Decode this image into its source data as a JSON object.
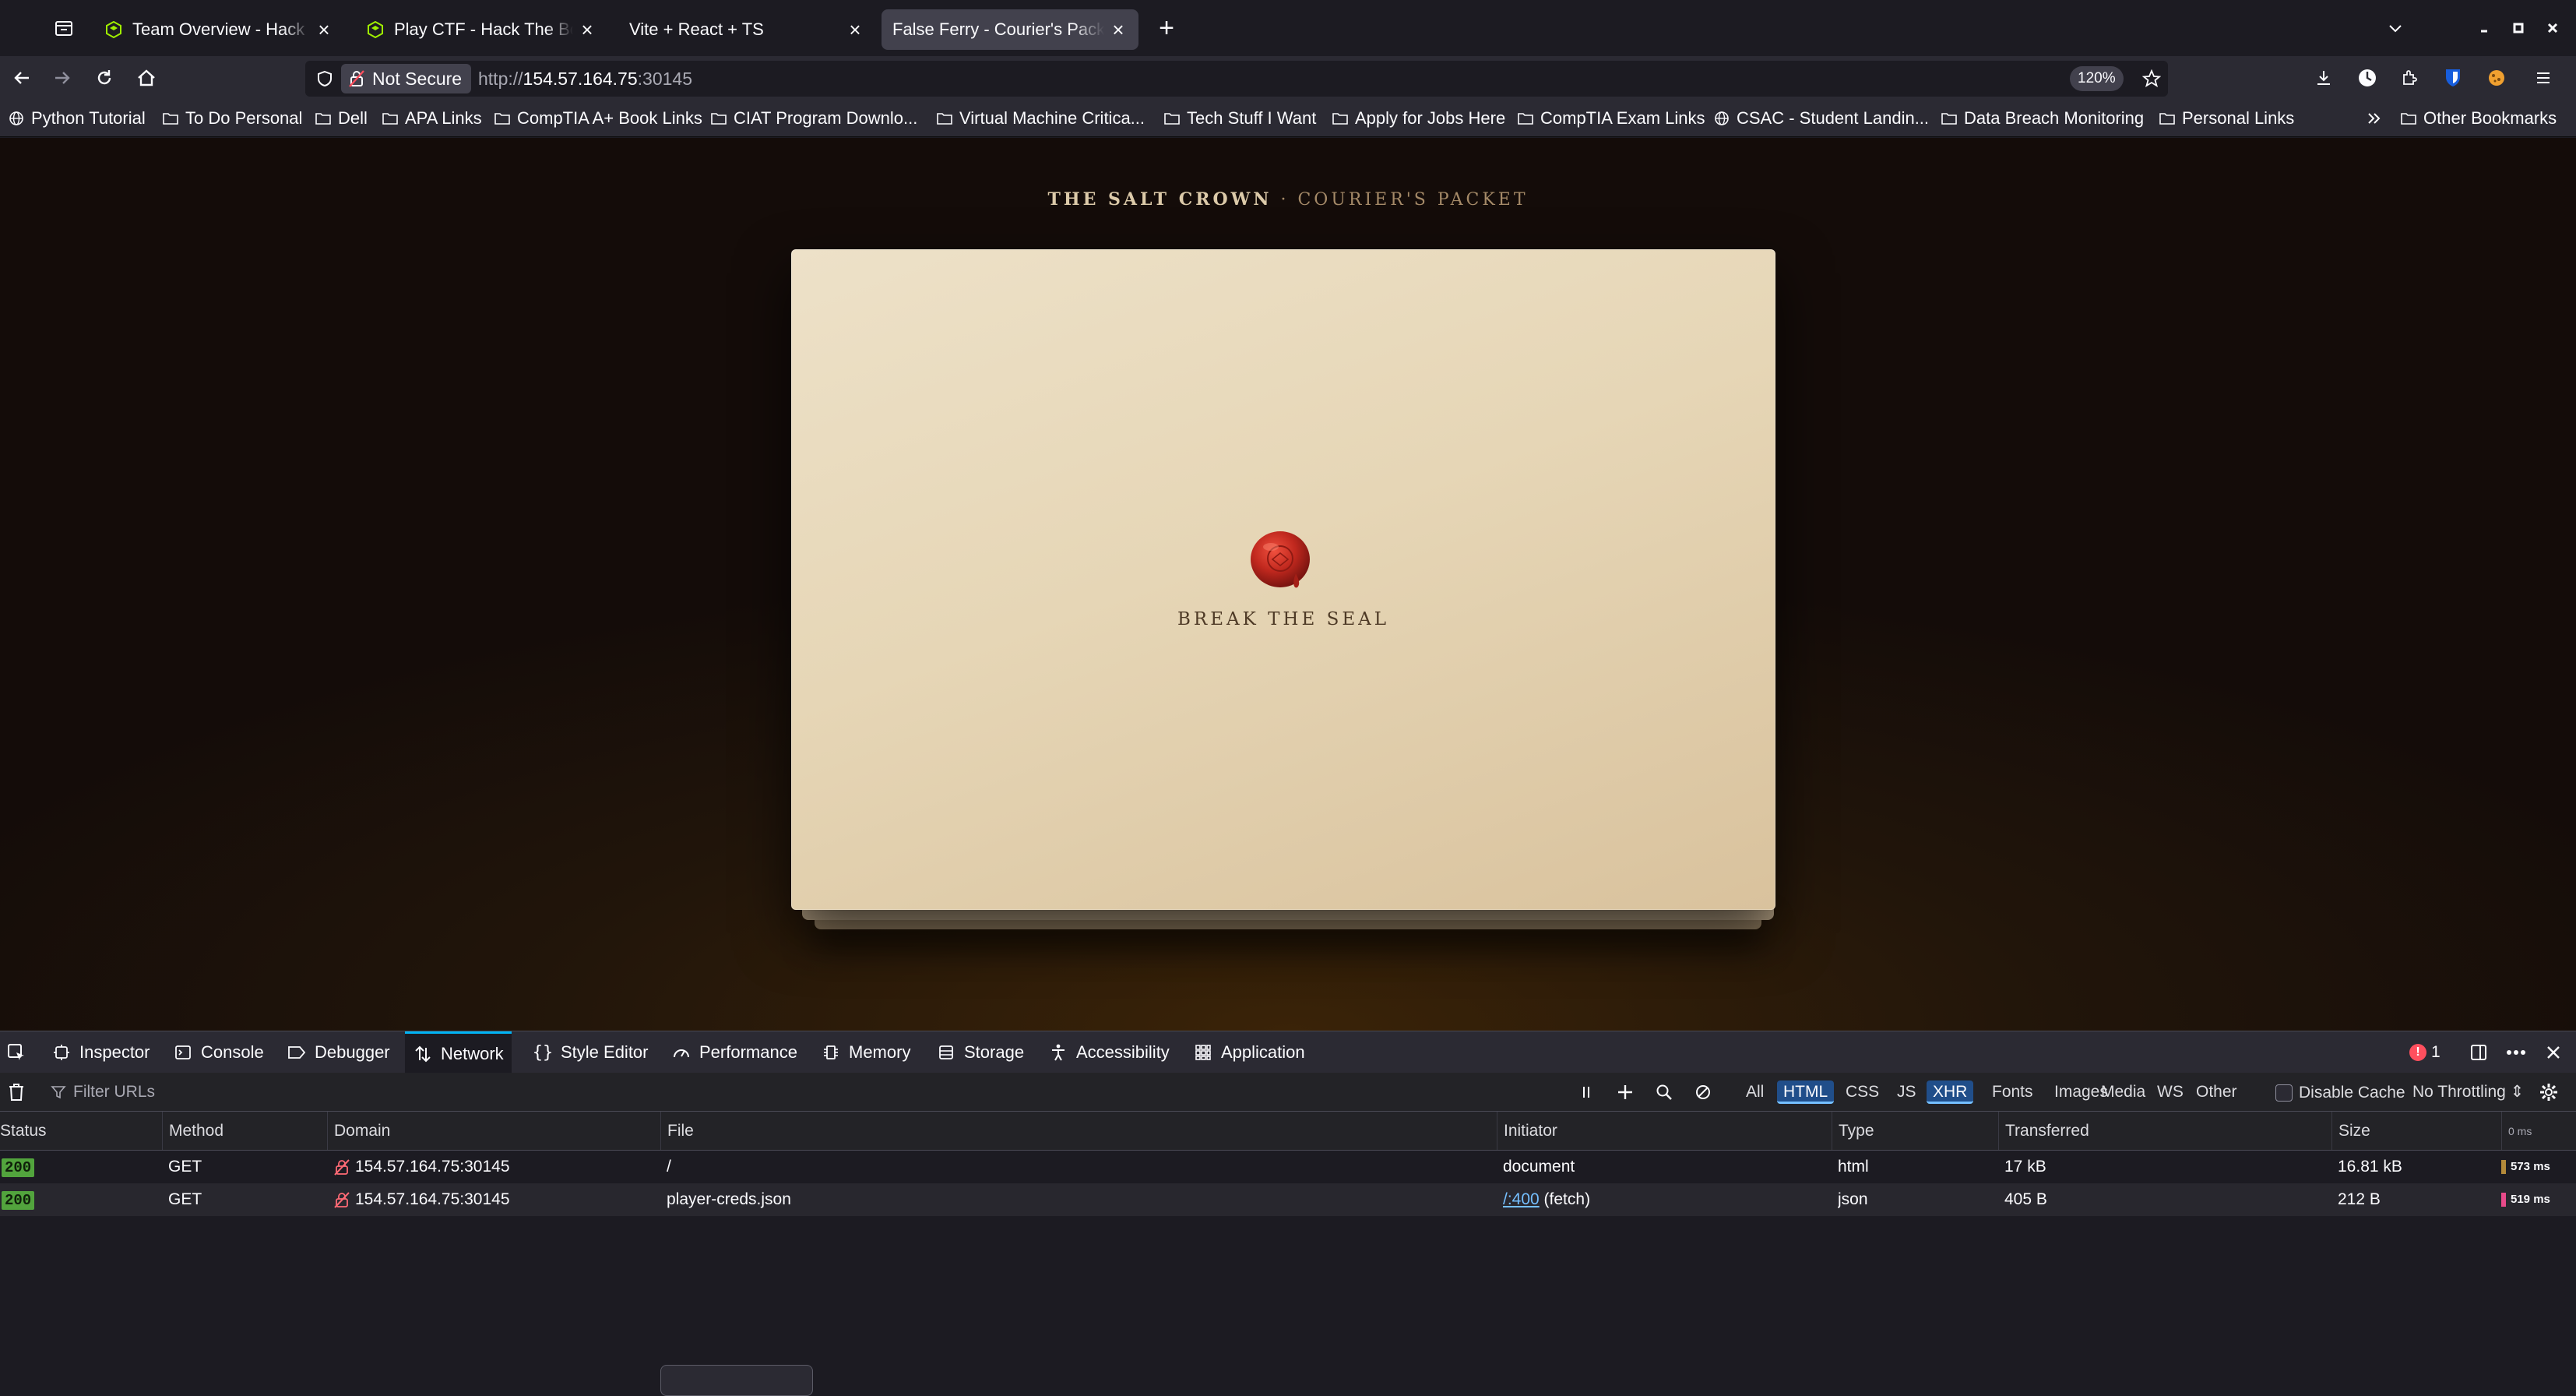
{
  "browser": {
    "tabs": [
      {
        "title": "Team Overview - Hack The Box",
        "active": false
      },
      {
        "title": "Play CTF - Hack The Box CTF",
        "active": false
      },
      {
        "title": "Vite + React + TS",
        "active": false
      },
      {
        "title": "False Ferry - Courier's Packet",
        "active": true
      }
    ],
    "new_tab_label": "+",
    "close_label": "×"
  },
  "navbar": {
    "not_secure_label": "Not Secure",
    "url_prefix": "http://",
    "url_host": "154.57.164.75",
    "url_port": ":30145",
    "zoom": "120%"
  },
  "bookmarks": [
    {
      "label": "Python Tutorial",
      "icon": "globe-icon"
    },
    {
      "label": "To Do Personal",
      "icon": "folder-icon"
    },
    {
      "label": "Dell",
      "icon": "folder-icon"
    },
    {
      "label": "APA Links",
      "icon": "folder-icon"
    },
    {
      "label": "CompTIA A+ Book Links",
      "icon": "folder-icon"
    },
    {
      "label": "CIAT Program Downlo...",
      "icon": "folder-icon"
    },
    {
      "label": "Virtual Machine Critica...",
      "icon": "folder-icon"
    },
    {
      "label": "Tech Stuff I Want",
      "icon": "folder-icon"
    },
    {
      "label": "Apply for Jobs Here",
      "icon": "folder-icon"
    },
    {
      "label": "CompTIA Exam Links",
      "icon": "folder-icon"
    },
    {
      "label": "CSAC - Student Landin...",
      "icon": "globe-icon"
    },
    {
      "label": "Data Breach Monitoring",
      "icon": "folder-icon"
    },
    {
      "label": "Personal Links",
      "icon": "folder-icon"
    }
  ],
  "other_bookmarks": "Other Bookmarks",
  "page": {
    "heading_main": "THE SALT CROWN",
    "heading_sep": " · ",
    "heading_sub": "COURIER'S PACKET",
    "seal_label": "BREAK THE SEAL",
    "seal_color": "#c0281e",
    "paper_color": "#e6d6b6"
  },
  "devtools": {
    "tabs": [
      {
        "label": "Inspector",
        "icon": "inspector-icon"
      },
      {
        "label": "Console",
        "icon": "console-icon"
      },
      {
        "label": "Debugger",
        "icon": "debugger-icon"
      },
      {
        "label": "Network",
        "icon": "network-icon",
        "active": true
      },
      {
        "label": "Style Editor",
        "icon": "braces-icon"
      },
      {
        "label": "Performance",
        "icon": "gauge-icon"
      },
      {
        "label": "Memory",
        "icon": "memory-icon"
      },
      {
        "label": "Storage",
        "icon": "storage-icon"
      },
      {
        "label": "Accessibility",
        "icon": "accessibility-icon"
      },
      {
        "label": "Application",
        "icon": "grid-icon"
      }
    ],
    "error_count": "1",
    "filter_placeholder": "Filter URLs",
    "type_filters": [
      {
        "label": "All",
        "on": false
      },
      {
        "label": "HTML",
        "on": true
      },
      {
        "label": "CSS",
        "on": false
      },
      {
        "label": "JS",
        "on": false
      },
      {
        "label": "XHR",
        "on": true
      },
      {
        "label": "Fonts",
        "on": false
      },
      {
        "label": "Images",
        "on": false
      },
      {
        "label": "Media",
        "on": false
      },
      {
        "label": "WS",
        "on": false
      },
      {
        "label": "Other",
        "on": false
      }
    ],
    "disable_cache_label": "Disable Cache",
    "throttling_label": "No Throttling ⇕",
    "columns": [
      "Status",
      "Method",
      "Domain",
      "File",
      "Initiator",
      "Type",
      "Transferred",
      "Size"
    ],
    "timeline_header": "0 ms",
    "requests": [
      {
        "status": "200",
        "method": "GET",
        "domain": "154.57.164.75:30145",
        "file": "/",
        "initiator": "document",
        "initiator_link": "",
        "type": "html",
        "transferred": "17 kB",
        "size": "16.81 kB",
        "time": "573 ms",
        "bar_color": "#b48a3a"
      },
      {
        "status": "200",
        "method": "GET",
        "domain": "154.57.164.75:30145",
        "file": "player-creds.json",
        "initiator": " (fetch)",
        "initiator_link": "/:400",
        "type": "json",
        "transferred": "405 B",
        "size": "212 B",
        "time": "519 ms",
        "bar_color": "#e84a8a"
      }
    ]
  }
}
